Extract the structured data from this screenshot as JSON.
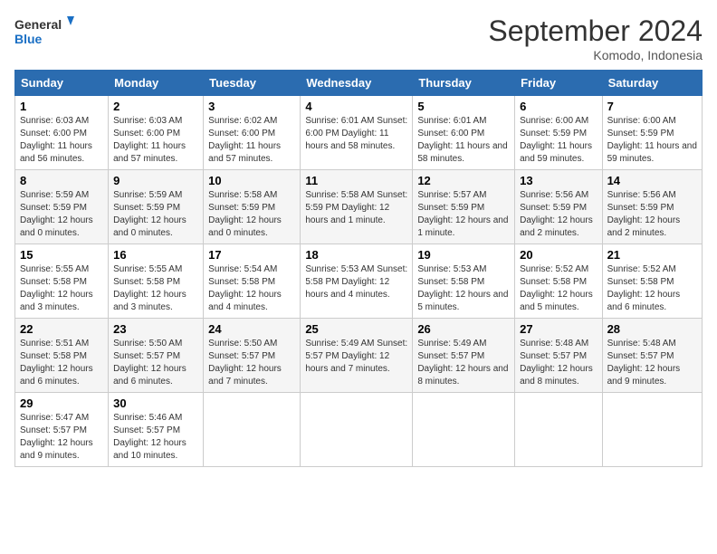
{
  "header": {
    "logo_line1": "General",
    "logo_line2": "Blue",
    "month": "September 2024",
    "location": "Komodo, Indonesia"
  },
  "weekdays": [
    "Sunday",
    "Monday",
    "Tuesday",
    "Wednesday",
    "Thursday",
    "Friday",
    "Saturday"
  ],
  "weeks": [
    [
      {
        "day": "1",
        "info": "Sunrise: 6:03 AM\nSunset: 6:00 PM\nDaylight: 11 hours\nand 56 minutes."
      },
      {
        "day": "2",
        "info": "Sunrise: 6:03 AM\nSunset: 6:00 PM\nDaylight: 11 hours\nand 57 minutes."
      },
      {
        "day": "3",
        "info": "Sunrise: 6:02 AM\nSunset: 6:00 PM\nDaylight: 11 hours\nand 57 minutes."
      },
      {
        "day": "4",
        "info": "Sunrise: 6:01 AM\nSunset: 6:00 PM\nDaylight: 11 hours\nand 58 minutes."
      },
      {
        "day": "5",
        "info": "Sunrise: 6:01 AM\nSunset: 6:00 PM\nDaylight: 11 hours\nand 58 minutes."
      },
      {
        "day": "6",
        "info": "Sunrise: 6:00 AM\nSunset: 5:59 PM\nDaylight: 11 hours\nand 59 minutes."
      },
      {
        "day": "7",
        "info": "Sunrise: 6:00 AM\nSunset: 5:59 PM\nDaylight: 11 hours\nand 59 minutes."
      }
    ],
    [
      {
        "day": "8",
        "info": "Sunrise: 5:59 AM\nSunset: 5:59 PM\nDaylight: 12 hours\nand 0 minutes."
      },
      {
        "day": "9",
        "info": "Sunrise: 5:59 AM\nSunset: 5:59 PM\nDaylight: 12 hours\nand 0 minutes."
      },
      {
        "day": "10",
        "info": "Sunrise: 5:58 AM\nSunset: 5:59 PM\nDaylight: 12 hours\nand 0 minutes."
      },
      {
        "day": "11",
        "info": "Sunrise: 5:58 AM\nSunset: 5:59 PM\nDaylight: 12 hours\nand 1 minute."
      },
      {
        "day": "12",
        "info": "Sunrise: 5:57 AM\nSunset: 5:59 PM\nDaylight: 12 hours\nand 1 minute."
      },
      {
        "day": "13",
        "info": "Sunrise: 5:56 AM\nSunset: 5:59 PM\nDaylight: 12 hours\nand 2 minutes."
      },
      {
        "day": "14",
        "info": "Sunrise: 5:56 AM\nSunset: 5:59 PM\nDaylight: 12 hours\nand 2 minutes."
      }
    ],
    [
      {
        "day": "15",
        "info": "Sunrise: 5:55 AM\nSunset: 5:58 PM\nDaylight: 12 hours\nand 3 minutes."
      },
      {
        "day": "16",
        "info": "Sunrise: 5:55 AM\nSunset: 5:58 PM\nDaylight: 12 hours\nand 3 minutes."
      },
      {
        "day": "17",
        "info": "Sunrise: 5:54 AM\nSunset: 5:58 PM\nDaylight: 12 hours\nand 4 minutes."
      },
      {
        "day": "18",
        "info": "Sunrise: 5:53 AM\nSunset: 5:58 PM\nDaylight: 12 hours\nand 4 minutes."
      },
      {
        "day": "19",
        "info": "Sunrise: 5:53 AM\nSunset: 5:58 PM\nDaylight: 12 hours\nand 5 minutes."
      },
      {
        "day": "20",
        "info": "Sunrise: 5:52 AM\nSunset: 5:58 PM\nDaylight: 12 hours\nand 5 minutes."
      },
      {
        "day": "21",
        "info": "Sunrise: 5:52 AM\nSunset: 5:58 PM\nDaylight: 12 hours\nand 6 minutes."
      }
    ],
    [
      {
        "day": "22",
        "info": "Sunrise: 5:51 AM\nSunset: 5:58 PM\nDaylight: 12 hours\nand 6 minutes."
      },
      {
        "day": "23",
        "info": "Sunrise: 5:50 AM\nSunset: 5:57 PM\nDaylight: 12 hours\nand 6 minutes."
      },
      {
        "day": "24",
        "info": "Sunrise: 5:50 AM\nSunset: 5:57 PM\nDaylight: 12 hours\nand 7 minutes."
      },
      {
        "day": "25",
        "info": "Sunrise: 5:49 AM\nSunset: 5:57 PM\nDaylight: 12 hours\nand 7 minutes."
      },
      {
        "day": "26",
        "info": "Sunrise: 5:49 AM\nSunset: 5:57 PM\nDaylight: 12 hours\nand 8 minutes."
      },
      {
        "day": "27",
        "info": "Sunrise: 5:48 AM\nSunset: 5:57 PM\nDaylight: 12 hours\nand 8 minutes."
      },
      {
        "day": "28",
        "info": "Sunrise: 5:48 AM\nSunset: 5:57 PM\nDaylight: 12 hours\nand 9 minutes."
      }
    ],
    [
      {
        "day": "29",
        "info": "Sunrise: 5:47 AM\nSunset: 5:57 PM\nDaylight: 12 hours\nand 9 minutes."
      },
      {
        "day": "30",
        "info": "Sunrise: 5:46 AM\nSunset: 5:57 PM\nDaylight: 12 hours\nand 10 minutes."
      },
      {
        "day": "",
        "info": ""
      },
      {
        "day": "",
        "info": ""
      },
      {
        "day": "",
        "info": ""
      },
      {
        "day": "",
        "info": ""
      },
      {
        "day": "",
        "info": ""
      }
    ]
  ]
}
